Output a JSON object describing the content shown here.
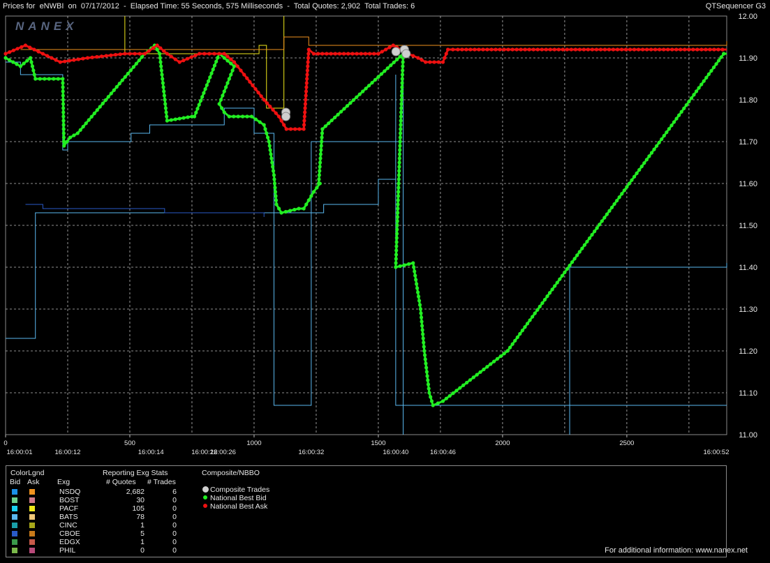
{
  "header": {
    "title": "Prices for  eNWBI  on  07/17/2012  -  Elapsed Time: 55 Seconds, 575 Milliseconds  -  Total Quotes: 2,902  Total Trades: 6",
    "app": "QTSequencer G3"
  },
  "footer": {
    "note": "For additional information: www.nanex.net"
  },
  "legend": {
    "color_title": "ColorLgnd",
    "bid_label": "Bid",
    "ask_label": "Ask",
    "exg_label": "Exg",
    "stats_title": "Reporting Exg Stats",
    "quotes_label": "# Quotes",
    "trades_label": "# Trades",
    "composite_title": "Composite/NBBO",
    "composite_items": [
      {
        "label": "Composite Trades",
        "color": "#cfcfcf"
      },
      {
        "label": "National Best Bid",
        "color": "#22ee22"
      },
      {
        "label": "National Best Ask",
        "color": "#ee1111"
      }
    ],
    "exchanges": [
      {
        "name": "NSDQ",
        "quotes": "2,682",
        "trades": "6",
        "bid_color": "#1a8fe8",
        "ask_color": "#f0921e"
      },
      {
        "name": "BOST",
        "quotes": "30",
        "trades": "0",
        "bid_color": "#6ccf8a",
        "ask_color": "#d07a8a"
      },
      {
        "name": "PACF",
        "quotes": "105",
        "trades": "0",
        "bid_color": "#1ad0f0",
        "ask_color": "#f0e81a"
      },
      {
        "name": "BATS",
        "quotes": "78",
        "trades": "0",
        "bid_color": "#5ab8f0",
        "ask_color": "#f0c878"
      },
      {
        "name": "CINC",
        "quotes": "1",
        "trades": "0",
        "bid_color": "#1a9fa8",
        "ask_color": "#a8a81a"
      },
      {
        "name": "CBOE",
        "quotes": "5",
        "trades": "0",
        "bid_color": "#2a5ac8",
        "ask_color": "#c87a1a"
      },
      {
        "name": "EDGX",
        "quotes": "1",
        "trades": "0",
        "bid_color": "#3a9a4a",
        "ask_color": "#c85a4a"
      },
      {
        "name": "PHIL",
        "quotes": "0",
        "trades": "0",
        "bid_color": "#7ab84a",
        "ask_color": "#b84a7a"
      }
    ]
  },
  "chart_data": {
    "type": "line",
    "logo": "NANEX",
    "ylim": [
      11.0,
      12.0
    ],
    "y_ticks": [
      "12.00",
      "11.90",
      "11.80",
      "11.70",
      "11.60",
      "11.50",
      "11.40",
      "11.30",
      "11.20",
      "11.10",
      "11.00"
    ],
    "xlim": [
      0,
      2902
    ],
    "x_ticks": [
      "0",
      "500",
      "1000",
      "1500",
      "2000",
      "2500"
    ],
    "time_labels": [
      {
        "x": 0,
        "label": "16:00:01"
      },
      {
        "x": 250,
        "label": "16:00:12"
      },
      {
        "x": 585,
        "label": "16:00:14"
      },
      {
        "x": 800,
        "label": "16:00:22"
      },
      {
        "x": 875,
        "label": "16:00:26"
      },
      {
        "x": 1230,
        "label": "16:00:32"
      },
      {
        "x": 1570,
        "label": "16:00:40"
      },
      {
        "x": 1760,
        "label": "16:00:46"
      },
      {
        "x": 2870,
        "label": "16:00:52"
      }
    ],
    "grid": true,
    "series": [
      {
        "name": "National Best Bid",
        "color": "#22ee22",
        "points": [
          [
            0,
            11.9
          ],
          [
            60,
            11.88
          ],
          [
            100,
            11.9
          ],
          [
            120,
            11.85
          ],
          [
            230,
            11.85
          ],
          [
            235,
            11.69
          ],
          [
            260,
            11.71
          ],
          [
            290,
            11.72
          ],
          [
            560,
            11.91
          ],
          [
            600,
            11.93
          ],
          [
            620,
            11.91
          ],
          [
            650,
            11.75
          ],
          [
            750,
            11.76
          ],
          [
            760,
            11.76
          ],
          [
            860,
            11.91
          ],
          [
            880,
            11.9
          ],
          [
            920,
            11.88
          ],
          [
            860,
            11.79
          ],
          [
            880,
            11.77
          ],
          [
            900,
            11.76
          ],
          [
            990,
            11.76
          ],
          [
            1040,
            11.74
          ],
          [
            1060,
            11.7
          ],
          [
            1080,
            11.62
          ],
          [
            1090,
            11.55
          ],
          [
            1110,
            11.53
          ],
          [
            1180,
            11.54
          ],
          [
            1200,
            11.54
          ],
          [
            1220,
            11.56
          ],
          [
            1240,
            11.58
          ],
          [
            1265,
            11.6
          ],
          [
            1260,
            11.6
          ],
          [
            1275,
            11.73
          ],
          [
            1600,
            11.91
          ],
          [
            1570,
            11.4
          ],
          [
            1640,
            11.41
          ],
          [
            1670,
            11.3
          ],
          [
            1685,
            11.2
          ],
          [
            1705,
            11.1
          ],
          [
            1720,
            11.07
          ],
          [
            1760,
            11.08
          ],
          [
            2020,
            11.2
          ],
          [
            2890,
            11.91
          ],
          [
            2890,
            11.91
          ],
          [
            2902,
            11.91
          ]
        ]
      },
      {
        "name": "National Best Ask",
        "color": "#ee1111",
        "points": [
          [
            0,
            11.91
          ],
          [
            80,
            11.93
          ],
          [
            150,
            11.91
          ],
          [
            220,
            11.89
          ],
          [
            330,
            11.9
          ],
          [
            480,
            11.91
          ],
          [
            560,
            11.91
          ],
          [
            610,
            11.93
          ],
          [
            650,
            11.91
          ],
          [
            700,
            11.89
          ],
          [
            780,
            11.91
          ],
          [
            880,
            11.91
          ],
          [
            920,
            11.89
          ],
          [
            960,
            11.86
          ],
          [
            1040,
            11.8
          ],
          [
            1100,
            11.76
          ],
          [
            1130,
            11.73
          ],
          [
            1200,
            11.73
          ],
          [
            1220,
            11.92
          ],
          [
            1240,
            11.91
          ],
          [
            1500,
            11.91
          ],
          [
            1560,
            11.93
          ],
          [
            1620,
            11.91
          ],
          [
            1660,
            11.9
          ],
          [
            1690,
            11.89
          ],
          [
            1760,
            11.89
          ],
          [
            1780,
            11.92
          ],
          [
            1820,
            11.92
          ],
          [
            2902,
            11.92
          ]
        ]
      },
      {
        "name": "Composite Trades",
        "color": "#cfcfcf",
        "points": [
          [
            1128,
            11.77
          ],
          [
            1128,
            11.76
          ],
          [
            1571,
            11.915
          ],
          [
            1605,
            11.92
          ],
          [
            1612,
            11.91
          ]
        ]
      }
    ]
  }
}
